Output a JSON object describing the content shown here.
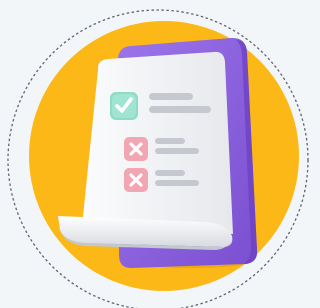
{
  "illustration": {
    "subject": "checklist",
    "icons": [
      "check-icon",
      "cross-icon",
      "cross-icon"
    ]
  },
  "colors": {
    "background": "#f3f6f9",
    "circle": "#fbb817",
    "dashed_ring": "#5d6573",
    "back_sheet": "#8c62dc",
    "paper": "#f2f3f6",
    "check_badge": "#8fdcc6",
    "cross_badge": "#f2a6b1",
    "lines": "#c5c8cf"
  }
}
